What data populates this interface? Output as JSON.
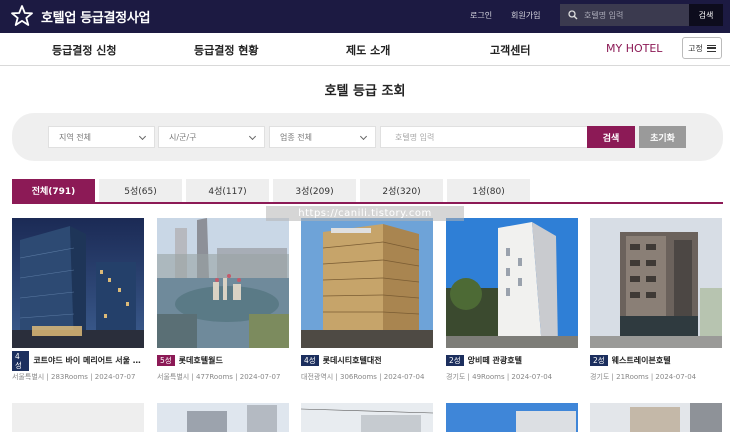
{
  "header": {
    "logo_text": "호텔업 등급결정사업",
    "login": "로그인",
    "signup": "회원가입",
    "search_placeholder": "호텔명 입력",
    "search_button": "검색"
  },
  "nav": {
    "items": [
      "등급결정 신청",
      "등급결정 현황",
      "제도 소개",
      "고객센터"
    ],
    "my_hotel": "MY HOTEL",
    "fix_button": "고정"
  },
  "page_title": "호텔 등급 조회",
  "filter": {
    "region": "지역 전체",
    "city": "시/군/구",
    "business_type": "업종 전체",
    "name_placeholder": "호텔명 입력",
    "search_label": "검색",
    "reset_label": "초기화"
  },
  "tabs": [
    "전체(791)",
    "5성(65)",
    "4성(117)",
    "3성(209)",
    "2성(320)",
    "1성(80)"
  ],
  "active_tab": "전체(791)",
  "watermark": "https://canili.tistory.com",
  "colors": {
    "brand": "#8c1a56",
    "navy": "#1c1a42",
    "grade_badge": "#1c2f5e"
  },
  "hotels": [
    {
      "grade": "4성",
      "name": "코트야드 바이 메리어트 서울 판교",
      "meta": "서울특별시 | 283Rooms | 2024-07-07"
    },
    {
      "grade": "5성",
      "name": "롯데호텔월드",
      "meta": "서울특별시 | 477Rooms | 2024-07-07"
    },
    {
      "grade": "4성",
      "name": "롯데시티호텔대전",
      "meta": "대전광역시 | 306Rooms | 2024-07-04"
    },
    {
      "grade": "2성",
      "name": "앙비떼 관광호텔",
      "meta": "경기도 | 49Rooms | 2024-07-04"
    },
    {
      "grade": "2성",
      "name": "웨스트레이븐호텔",
      "meta": "경기도 | 21Rooms | 2024-07-04"
    }
  ]
}
